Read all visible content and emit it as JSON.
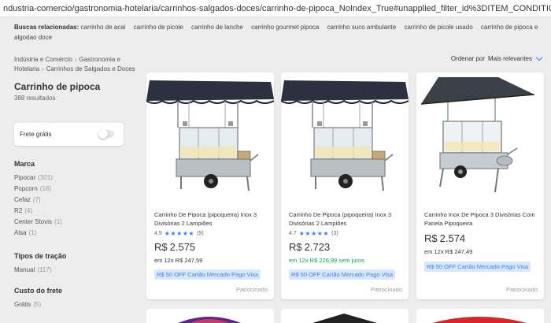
{
  "browser": {
    "url": "ndustria-comercio/gastronomia-hotelaria/carrinhos-salgados-doces/carrinho-de-pipoca_NoIndex_True#unapplied_filter_id%3DITEM_CONDITION%26unapplied_filter_name%3DCondi"
  },
  "related": {
    "label": "Buscas relacionadas:",
    "links": [
      "carrinho de acai",
      "carrinho de picole",
      "carrinho de lanche",
      "carrinho gourmet pipoca",
      "carrinho suco ambulante",
      "carrinho de picole usado",
      "carrinho de pipoca e algodao doce"
    ]
  },
  "breadcrumb": [
    "Indústria e Comércio",
    "Gastronomia e Hotelaria",
    "Carrinhos de Salgados e Doces"
  ],
  "page": {
    "title": "Carrinho de pipoca",
    "results": "388 resultados"
  },
  "sort": {
    "label": "Ordenar por",
    "value": "Mais relevantes"
  },
  "frete_gratis": {
    "label": "Frete grátis",
    "enabled": false
  },
  "filters": {
    "marca": {
      "title": "Marca",
      "items": [
        {
          "name": "Pipocar",
          "count": "(301)"
        },
        {
          "name": "Popcorn",
          "count": "(18)"
        },
        {
          "name": "Cefaz",
          "count": "(7)"
        },
        {
          "name": "R2",
          "count": "(4)"
        },
        {
          "name": "Center Stovis",
          "count": "(1)"
        },
        {
          "name": "Alsa",
          "count": "(1)"
        }
      ]
    },
    "tracao": {
      "title": "Tipos de tração",
      "items": [
        {
          "name": "Manual",
          "count": "(117)"
        }
      ]
    },
    "frete": {
      "title": "Custo do frete",
      "items": [
        {
          "name": "Grátis",
          "count": "(5)"
        }
      ]
    }
  },
  "products": [
    {
      "title": "Carrinho De Pipoca (pipoqueira) Inox 3 Divisórias 2 Lampiões",
      "rating": "4.9",
      "stars": "★★★★★",
      "reviews": "(9)",
      "currency": "R$",
      "price": "2.575",
      "installments": "em 12x R$ 247,59",
      "promo": "R$ 50 OFF Cartão Mercado Pago Visa",
      "sponsored": "Patrocinado"
    },
    {
      "title": "Carrinho De Pipoca (pipoqueira) Inox 3 Divisórias 2 Lampiões",
      "rating": "4.7",
      "stars": "★★★★★",
      "reviews": "(3)",
      "currency": "R$",
      "price": "2.723",
      "installments": "em 12x R$ 226,99 sem juros",
      "promo": "R$ 50 OFF Cartão Mercado Pago Visa",
      "sponsored": "Patrocinado"
    },
    {
      "title": "Carrinho Inox De Pipoca 3 Divisórias Com Panela Pipoqueira",
      "currency": "R$",
      "price": "2.574",
      "installments": "em 12x R$ 247,49",
      "promo": "R$ 50 OFF Cartão Mercado Pago Visa",
      "sponsored": "Patrocinado"
    }
  ],
  "colors": {
    "accent": "#3483fa",
    "green": "#00a650",
    "promo_bg": "#d9e7fa",
    "awning": "#2c3140"
  }
}
